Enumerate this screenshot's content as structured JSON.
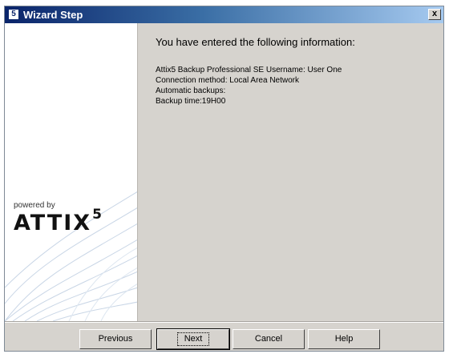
{
  "window": {
    "title": "Wizard Step",
    "app_icon_glyph": "5",
    "close_glyph": "x"
  },
  "sidebar": {
    "powered_by": "powered by",
    "logo_text": "ATTIX",
    "logo_superscript": "5"
  },
  "content": {
    "heading": "You have entered the following information:",
    "lines": [
      "Attix5 Backup Professional SE Username: User One",
      "Connection method: Local Area Network",
      "Automatic backups:",
      "Backup time:19H00"
    ]
  },
  "buttons": {
    "previous": "Previous",
    "next": "Next",
    "cancel": "Cancel",
    "help": "Help"
  },
  "colors": {
    "titlebar_start": "#0a246a",
    "titlebar_end": "#a6caf0",
    "panel": "#d6d3ce"
  }
}
